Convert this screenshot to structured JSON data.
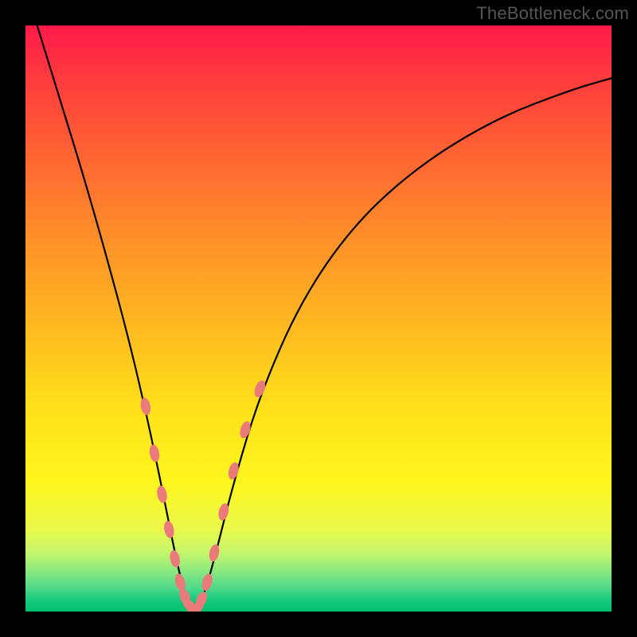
{
  "watermark": "TheBottleneck.com",
  "chart_data": {
    "type": "line",
    "title": "",
    "xlabel": "",
    "ylabel": "",
    "xlim": [
      0,
      1
    ],
    "ylim": [
      0,
      1
    ],
    "series": [
      {
        "name": "bottleneck-curve",
        "x": [
          0.02,
          0.06,
          0.1,
          0.14,
          0.18,
          0.21,
          0.235,
          0.255,
          0.27,
          0.285,
          0.3,
          0.32,
          0.355,
          0.4,
          0.47,
          0.56,
          0.67,
          0.8,
          0.93,
          1.0
        ],
        "values": [
          1.0,
          0.87,
          0.74,
          0.6,
          0.45,
          0.32,
          0.2,
          0.1,
          0.035,
          0.0,
          0.015,
          0.08,
          0.22,
          0.37,
          0.53,
          0.66,
          0.76,
          0.84,
          0.89,
          0.91
        ]
      }
    ],
    "markers": {
      "name": "highlight-dots",
      "color": "#eb7b7b",
      "points": [
        {
          "x": 0.205,
          "y": 0.35
        },
        {
          "x": 0.22,
          "y": 0.27
        },
        {
          "x": 0.233,
          "y": 0.2
        },
        {
          "x": 0.245,
          "y": 0.14
        },
        {
          "x": 0.255,
          "y": 0.09
        },
        {
          "x": 0.264,
          "y": 0.05
        },
        {
          "x": 0.272,
          "y": 0.025
        },
        {
          "x": 0.28,
          "y": 0.01
        },
        {
          "x": 0.29,
          "y": 0.005
        },
        {
          "x": 0.3,
          "y": 0.02
        },
        {
          "x": 0.31,
          "y": 0.05
        },
        {
          "x": 0.322,
          "y": 0.1
        },
        {
          "x": 0.338,
          "y": 0.17
        },
        {
          "x": 0.355,
          "y": 0.24
        },
        {
          "x": 0.375,
          "y": 0.31
        },
        {
          "x": 0.4,
          "y": 0.38
        }
      ]
    },
    "gradient_stops": [
      {
        "pos": 0.0,
        "color": "#ff1a4a"
      },
      {
        "pos": 0.5,
        "color": "#ffd21a"
      },
      {
        "pos": 0.86,
        "color": "#eaf84a"
      },
      {
        "pos": 1.0,
        "color": "#00c06e"
      }
    ]
  }
}
